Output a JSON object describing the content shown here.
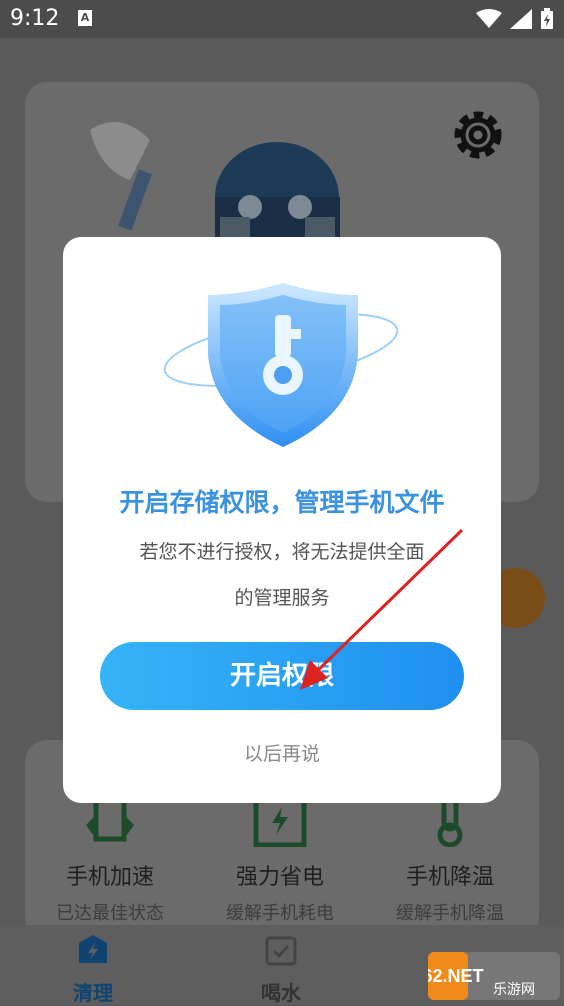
{
  "status_bar": {
    "time": "9:12",
    "notification_letter": "A"
  },
  "dialog": {
    "title": "开启存储权限，管理手机文件",
    "description_line1": "若您不进行授权，将无法提供全面",
    "description_line2": "的管理服务",
    "primary_button": "开启权限",
    "secondary_link": "以后再说"
  },
  "features": [
    {
      "title": "手机加速",
      "subtitle": "已达最佳状态"
    },
    {
      "title": "强力省电",
      "subtitle": "缓解手机耗电"
    },
    {
      "title": "手机降温",
      "subtitle": "缓解手机降温"
    }
  ],
  "tabs": [
    {
      "label": "清理"
    },
    {
      "label": "喝水"
    }
  ],
  "watermark": {
    "text_top": "962.NET",
    "text_bottom": "乐游网"
  },
  "colors": {
    "accent": "#3a92e0",
    "button_start": "#36b4f7",
    "button_end": "#1f8ff0",
    "overlay": "#5a5a5a"
  }
}
